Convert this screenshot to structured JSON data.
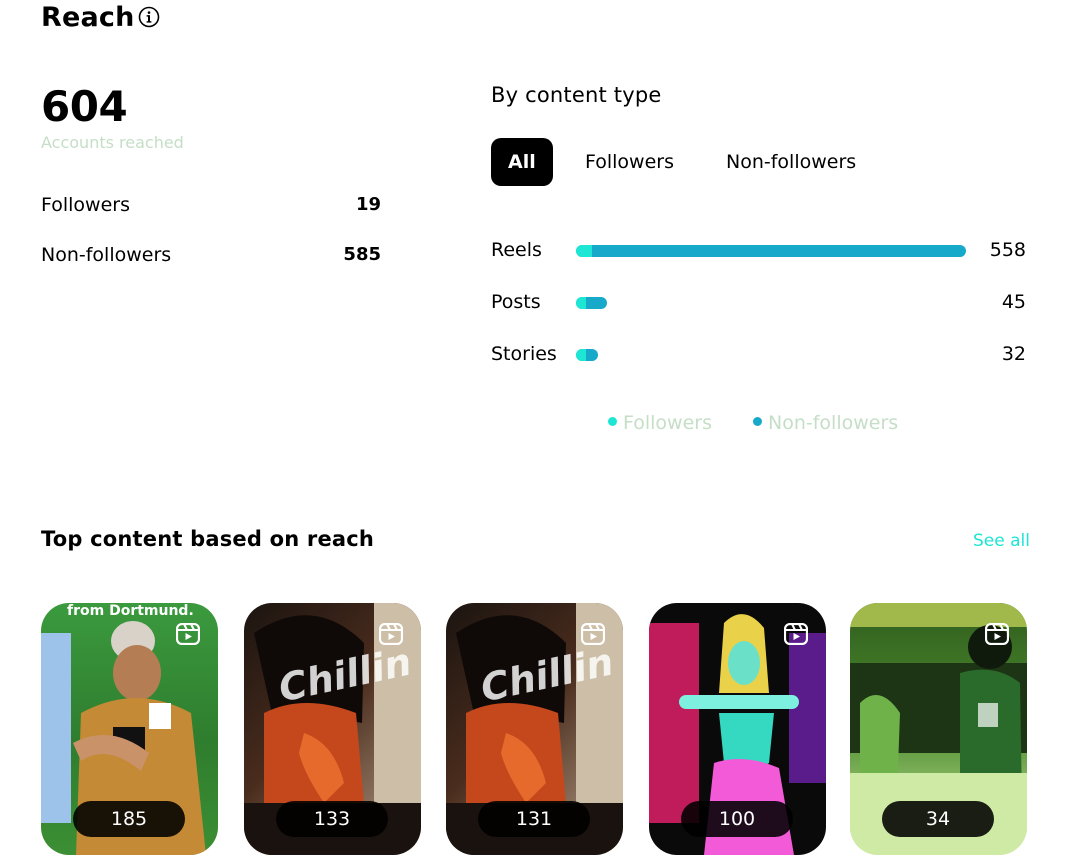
{
  "header": {
    "title": "Reach",
    "info_icon": "info-circle-icon"
  },
  "summary": {
    "total": "604",
    "caption": "Accounts reached"
  },
  "audience": [
    {
      "label": "Followers",
      "value": "19"
    },
    {
      "label": "Non-followers",
      "value": "585"
    }
  ],
  "content_type": {
    "heading": "By content type",
    "filters": [
      "All",
      "Followers",
      "Non-followers"
    ],
    "active_filter": "All",
    "rows": [
      {
        "label": "Reels",
        "value": "558",
        "total": 558,
        "followers_share": 0.04
      },
      {
        "label": "Posts",
        "value": "45",
        "total": 45,
        "followers_share": 0.25
      },
      {
        "label": "Stories",
        "value": "32",
        "total": 32,
        "followers_share": 0.3
      }
    ],
    "legend": [
      {
        "label": "Followers",
        "color": "#1ee6d4"
      },
      {
        "label": "Non-followers",
        "color": "#17a9c9"
      }
    ]
  },
  "top_content": {
    "heading": "Top content based on reach",
    "see_all": "See all",
    "items": [
      {
        "count": "185",
        "overlay_top": "from Dortmund."
      },
      {
        "count": "133",
        "overlay_mid": "Chillin"
      },
      {
        "count": "131",
        "overlay_mid": "Chillin"
      },
      {
        "count": "100"
      },
      {
        "count": "34"
      }
    ]
  },
  "colors": {
    "accent": "#1ee6d4",
    "bar": "#17a9c9",
    "muted": "#c5dec6"
  }
}
